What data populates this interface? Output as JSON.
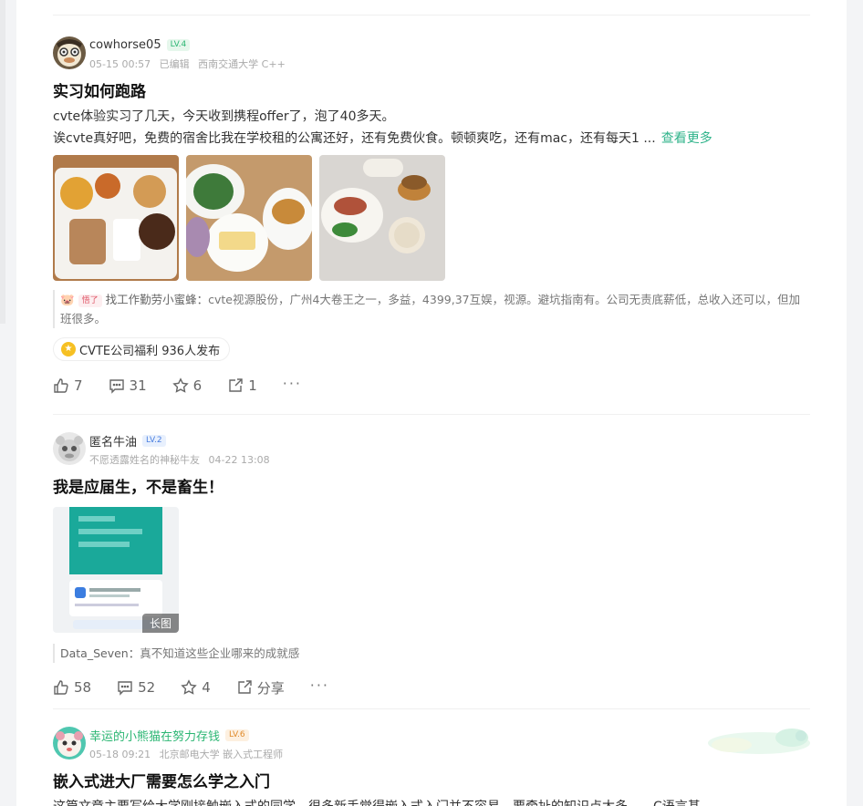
{
  "posts": [
    {
      "username": "cowhorse05",
      "level": "LV.4",
      "meta": {
        "time": "05-15 00:57",
        "edited": "已编辑",
        "school": "西南交通大学 C++"
      },
      "title": "实习如何跑路",
      "lines": [
        "cvte体验实习了几天，今天收到携程offer了，泡了40多天。",
        "诶cvte真好吧，免费的宿舍比我在学校租的公寓还好，还有免费伙食。顿顿爽吃，还有mac，还有每天1 ..."
      ],
      "more": "查看更多",
      "comment": {
        "badge": "悟了",
        "author": "找工作勤劳小蜜蜂：",
        "text": "cvte视源股份，广州4大卷王之一，多益，4399,37互娱，视源。避坑指南有。公司无责底薪低，总收入还可以，但加班很多。"
      },
      "topic": "CVTE公司福利 936人发布",
      "actions": {
        "like": "7",
        "comment": "31",
        "star": "6",
        "share": "1"
      }
    },
    {
      "username": "匿名牛油",
      "level": "LV.2",
      "meta": {
        "alias": "不愿透露姓名的神秘牛友",
        "time": "04-22 13:08"
      },
      "title": "我是应届生，不是畜生！",
      "image_tag": "长图",
      "comment": {
        "author": "Data_Seven：",
        "text": "真不知道这些企业哪来的成就感"
      },
      "actions": {
        "like": "58",
        "comment": "52",
        "star": "4",
        "share": "分享"
      }
    },
    {
      "username": "幸运的小熊猫在努力存钱",
      "level": "LV.6",
      "meta": {
        "time": "05-18 09:21",
        "school": "北京邮电大学 嵌入式工程师"
      },
      "title": "嵌入式进大厂需要怎么学之入门",
      "line": "这篇文章主要写给大学刚接触嵌入式的同学，很多新手觉得嵌入式入门并不容易，要牵扯的知识点太多……C语言基"
    }
  ],
  "colors": {
    "accent": "#2fb38a",
    "level_green": "#2bb673",
    "level_blue": "#4a7fe0",
    "level_orange": "#e08a2a"
  }
}
